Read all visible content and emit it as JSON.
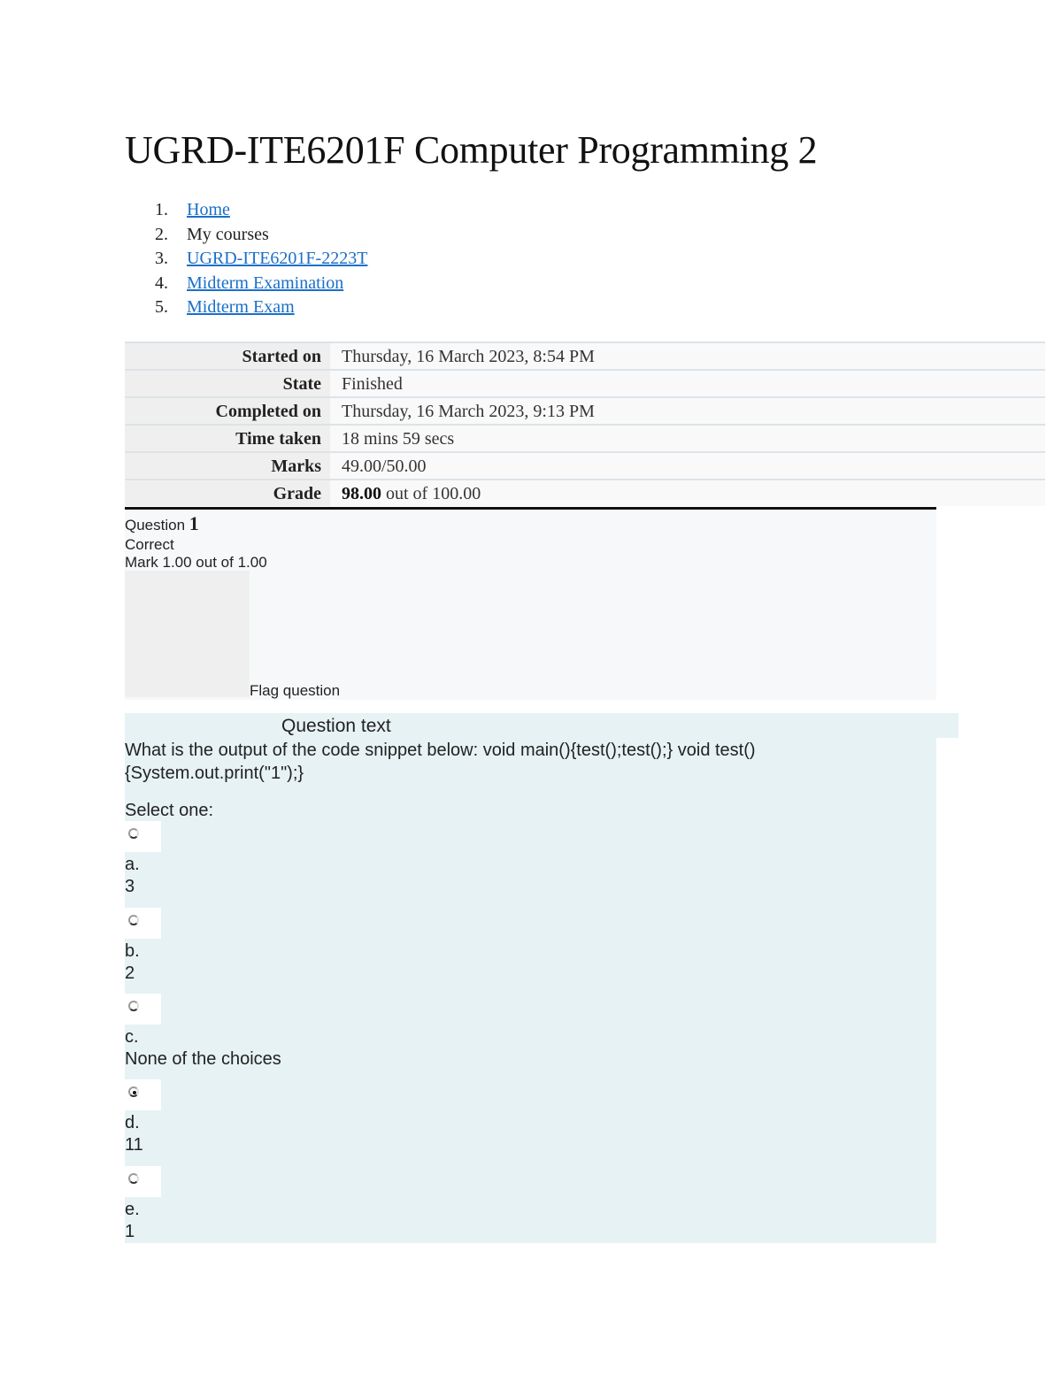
{
  "page": {
    "title": "UGRD-ITE6201F Computer Programming 2"
  },
  "breadcrumb": [
    {
      "number": "1.",
      "label": "Home",
      "link": true
    },
    {
      "number": "2.",
      "label": "My courses",
      "link": false
    },
    {
      "number": "3.",
      "label": "UGRD-ITE6201F-2223T",
      "link": true
    },
    {
      "number": "4.",
      "label": "Midterm Examination",
      "link": true
    },
    {
      "number": "5.",
      "label": "Midterm Exam",
      "link": true
    }
  ],
  "summary": {
    "rows": [
      {
        "label": "Started on",
        "value": "Thursday, 16 March 2023, 8:54 PM"
      },
      {
        "label": "State",
        "value": "Finished"
      },
      {
        "label": "Completed on",
        "value": "Thursday, 16 March 2023, 9:13 PM"
      },
      {
        "label": "Time taken",
        "value": "18 mins 59 secs"
      },
      {
        "label": "Marks",
        "value": "49.00/50.00"
      }
    ],
    "grade": {
      "label": "Grade",
      "score": "98.00",
      "suffix": " out of 100.00"
    }
  },
  "question": {
    "prefix": "Question ",
    "number": "1",
    "state": "Correct",
    "mark": "Mark 1.00 out of 1.00",
    "flag_label": "Flag question",
    "text_heading": "Question text",
    "text": "What is the output of the code snippet below: void main(){test();test();} void test(){System.out.print(\"1\");}",
    "prompt": "Select one:",
    "answers": [
      {
        "letter": "a.",
        "text": "3",
        "selected": false
      },
      {
        "letter": "b.",
        "text": "2",
        "selected": false
      },
      {
        "letter": "c.",
        "text": "None of the choices",
        "selected": false
      },
      {
        "letter": "d.",
        "text": "11",
        "selected": true
      },
      {
        "letter": "e.",
        "text": "1",
        "selected": false
      }
    ]
  },
  "colors": {
    "link": "#1a6fc9",
    "info_bg": "#f7f8fa",
    "content_bg": "#e7f2f5"
  }
}
